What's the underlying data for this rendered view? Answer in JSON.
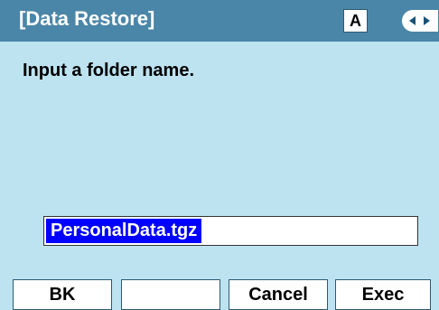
{
  "title_bar": {
    "title": "[Data Restore]",
    "input_mode": "A",
    "scroll_indicator_icon": "left-right-arrows-icon"
  },
  "main": {
    "prompt": "Input a folder name.",
    "folder_input": {
      "value": "PersonalData.tgz",
      "selected": true
    }
  },
  "softkeys": [
    {
      "label": "BK"
    },
    {
      "label": ""
    },
    {
      "label": "Cancel"
    },
    {
      "label": "Exec"
    }
  ],
  "colors": {
    "title_bar_bg": "#4a86a8",
    "screen_bg": "#bde3f0",
    "selection_bg": "#0000ff"
  }
}
